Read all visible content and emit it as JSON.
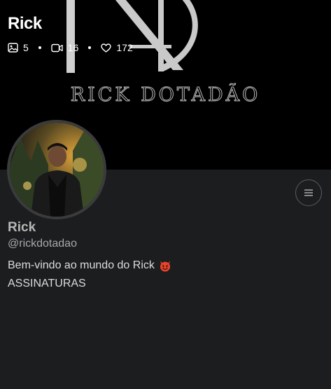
{
  "profile": {
    "title": "Rick",
    "name": "Rick",
    "handle": "@rickdotadao",
    "bio": "Bem-vindo ao mundo do Rick",
    "bio_emoji": "smiling-devil-icon",
    "link_text": "ASSINATURAS"
  },
  "banner": {
    "logo_text": "RICK DOTADÃO",
    "logo_color": "#b9b9b9",
    "background": "#000000"
  },
  "stats": {
    "photos": "5",
    "videos": "16",
    "likes": "172"
  },
  "icons": {
    "photos": "image-icon",
    "videos": "video-camera-icon",
    "likes": "heart-icon",
    "menu": "hamburger-menu-icon"
  },
  "colors": {
    "page_background": "#1c1d1f",
    "text": "#e8e8e8",
    "muted": "#a9a9a9"
  }
}
